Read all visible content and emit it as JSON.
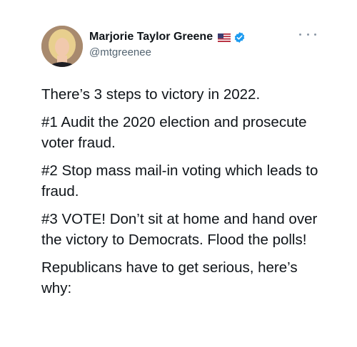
{
  "tweet": {
    "author": {
      "display_name": "Marjorie Taylor Greene",
      "handle": "@mtgreenee",
      "flag_icon": "us-flag-icon",
      "verified_icon": "verified-badge-icon",
      "verified_color": "#1d9bf0"
    },
    "more_icon": "more-options-icon",
    "paragraphs": [
      "There’s 3 steps to victory in 2022.",
      "#1 Audit the 2020 election and prosecute voter fraud.",
      "#2 Stop mass mail-in voting which leads to fraud.",
      "#3 VOTE! Don’t sit at home and hand over the victory to Democrats. Flood the polls!",
      "Republicans have to get serious, here’s why:"
    ]
  }
}
